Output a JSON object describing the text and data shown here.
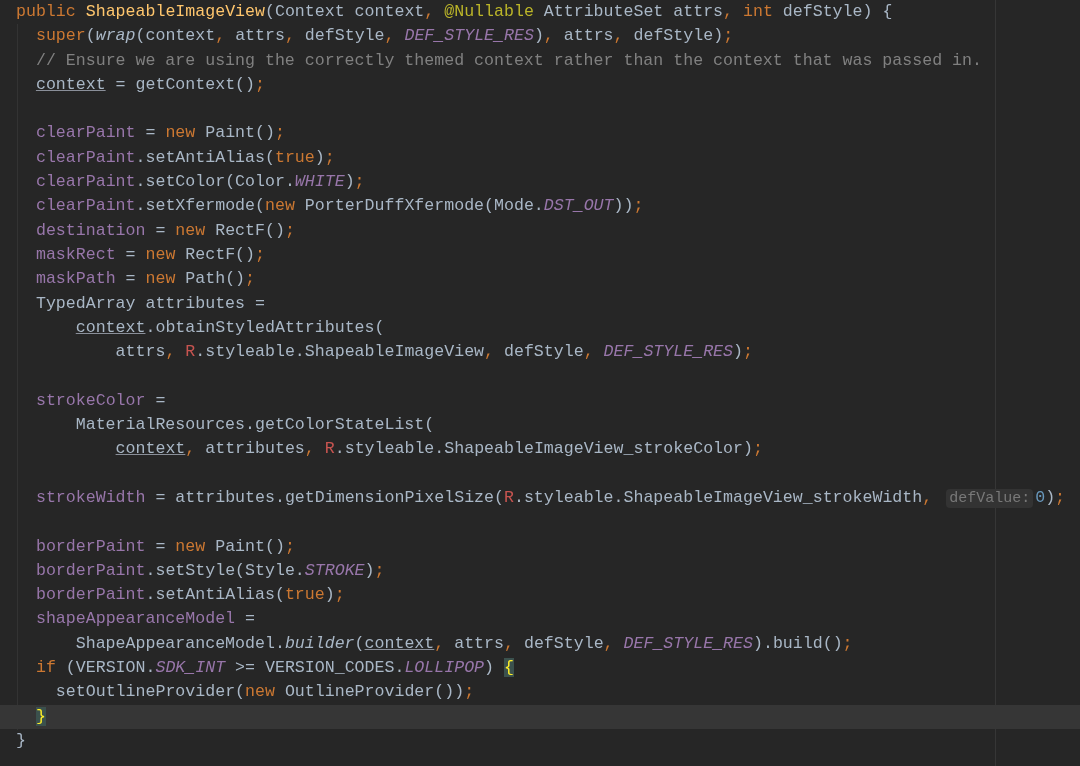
{
  "editor": {
    "lines": [
      {
        "current": false,
        "tokens": [
          {
            "kind": "keyword",
            "text": "public "
          },
          {
            "kind": "decl",
            "text": "ShapeableImageView"
          },
          {
            "kind": "plain",
            "text": "(Context context"
          },
          {
            "kind": "keyword",
            "text": ", "
          },
          {
            "kind": "annotation",
            "text": "@Nullable"
          },
          {
            "kind": "plain",
            "text": " AttributeSet attrs"
          },
          {
            "kind": "keyword",
            "text": ", int "
          },
          {
            "kind": "plain",
            "text": "defStyle) {"
          }
        ]
      },
      {
        "current": false,
        "tokens": [
          {
            "kind": "keyword",
            "text": "  super"
          },
          {
            "kind": "plain",
            "text": "("
          },
          {
            "kind": "italic",
            "text": "wrap"
          },
          {
            "kind": "plain",
            "text": "(context"
          },
          {
            "kind": "keyword",
            "text": ", "
          },
          {
            "kind": "plain",
            "text": "attrs"
          },
          {
            "kind": "keyword",
            "text": ", "
          },
          {
            "kind": "plain",
            "text": "defStyle"
          },
          {
            "kind": "keyword",
            "text": ", "
          },
          {
            "kind": "constant",
            "text": "DEF_STYLE_RES"
          },
          {
            "kind": "plain",
            "text": ")"
          },
          {
            "kind": "keyword",
            "text": ", "
          },
          {
            "kind": "plain",
            "text": "attrs"
          },
          {
            "kind": "keyword",
            "text": ", "
          },
          {
            "kind": "plain",
            "text": "defStyle)"
          },
          {
            "kind": "keyword",
            "text": ";"
          }
        ]
      },
      {
        "current": false,
        "tokens": [
          {
            "kind": "comment",
            "text": "  // Ensure we are using the correctly themed context rather than the context that was passed in."
          }
        ]
      },
      {
        "current": false,
        "tokens": [
          {
            "kind": "underline",
            "text": "  context"
          },
          {
            "kind": "plain",
            "text": " = getContext()"
          },
          {
            "kind": "keyword",
            "text": ";"
          }
        ]
      },
      {
        "current": false
      },
      {
        "current": false,
        "tokens": [
          {
            "kind": "field",
            "text": "  clearPaint"
          },
          {
            "kind": "plain",
            "text": " = "
          },
          {
            "kind": "keyword",
            "text": "new "
          },
          {
            "kind": "plain",
            "text": "Paint()"
          },
          {
            "kind": "keyword",
            "text": ";"
          }
        ]
      },
      {
        "current": false,
        "tokens": [
          {
            "kind": "field",
            "text": "  clearPaint"
          },
          {
            "kind": "plain",
            "text": ".setAntiAlias("
          },
          {
            "kind": "keyword",
            "text": "true"
          },
          {
            "kind": "plain",
            "text": ")"
          },
          {
            "kind": "keyword",
            "text": ";"
          }
        ]
      },
      {
        "current": false,
        "tokens": [
          {
            "kind": "field",
            "text": "  clearPaint"
          },
          {
            "kind": "plain",
            "text": ".setColor(Color."
          },
          {
            "kind": "constant",
            "text": "WHITE"
          },
          {
            "kind": "plain",
            "text": ")"
          },
          {
            "kind": "keyword",
            "text": ";"
          }
        ]
      },
      {
        "current": false,
        "tokens": [
          {
            "kind": "field",
            "text": "  clearPaint"
          },
          {
            "kind": "plain",
            "text": ".setXfermode("
          },
          {
            "kind": "keyword",
            "text": "new "
          },
          {
            "kind": "plain",
            "text": "PorterDuffXfermode(Mode."
          },
          {
            "kind": "constant",
            "text": "DST_OUT"
          },
          {
            "kind": "plain",
            "text": "))"
          },
          {
            "kind": "keyword",
            "text": ";"
          }
        ]
      },
      {
        "current": false,
        "tokens": [
          {
            "kind": "field",
            "text": "  destination"
          },
          {
            "kind": "plain",
            "text": " = "
          },
          {
            "kind": "keyword",
            "text": "new "
          },
          {
            "kind": "plain",
            "text": "RectF()"
          },
          {
            "kind": "keyword",
            "text": ";"
          }
        ]
      },
      {
        "current": false,
        "tokens": [
          {
            "kind": "field",
            "text": "  maskRect"
          },
          {
            "kind": "plain",
            "text": " = "
          },
          {
            "kind": "keyword",
            "text": "new "
          },
          {
            "kind": "plain",
            "text": "RectF()"
          },
          {
            "kind": "keyword",
            "text": ";"
          }
        ]
      },
      {
        "current": false,
        "tokens": [
          {
            "kind": "field",
            "text": "  maskPath"
          },
          {
            "kind": "plain",
            "text": " = "
          },
          {
            "kind": "keyword",
            "text": "new "
          },
          {
            "kind": "plain",
            "text": "Path()"
          },
          {
            "kind": "keyword",
            "text": ";"
          }
        ]
      },
      {
        "current": false,
        "tokens": [
          {
            "kind": "plain",
            "text": "  TypedArray attributes ="
          }
        ]
      },
      {
        "current": false,
        "tokens": [
          {
            "kind": "underline",
            "text": "      context"
          },
          {
            "kind": "plain",
            "text": ".obtainStyledAttributes("
          }
        ]
      },
      {
        "current": false,
        "tokens": [
          {
            "kind": "plain",
            "text": "          attrs"
          },
          {
            "kind": "keyword",
            "text": ", "
          },
          {
            "kind": "resource",
            "text": "R"
          },
          {
            "kind": "plain",
            "text": ".styleable.ShapeableImageView"
          },
          {
            "kind": "keyword",
            "text": ", "
          },
          {
            "kind": "plain",
            "text": "defStyle"
          },
          {
            "kind": "keyword",
            "text": ", "
          },
          {
            "kind": "constant",
            "text": "DEF_STYLE_RES"
          },
          {
            "kind": "plain",
            "text": ")"
          },
          {
            "kind": "keyword",
            "text": ";"
          }
        ]
      },
      {
        "current": false
      },
      {
        "current": false,
        "tokens": [
          {
            "kind": "field",
            "text": "  strokeColor"
          },
          {
            "kind": "plain",
            "text": " ="
          }
        ]
      },
      {
        "current": false,
        "tokens": [
          {
            "kind": "plain",
            "text": "      MaterialResources.getColorStateList("
          }
        ]
      },
      {
        "current": false,
        "tokens": [
          {
            "kind": "underline",
            "text": "          context"
          },
          {
            "kind": "keyword",
            "text": ", "
          },
          {
            "kind": "plain",
            "text": "attributes"
          },
          {
            "kind": "keyword",
            "text": ", "
          },
          {
            "kind": "resource",
            "text": "R"
          },
          {
            "kind": "plain",
            "text": ".styleable.ShapeableImageView_strokeColor)"
          },
          {
            "kind": "keyword",
            "text": ";"
          }
        ]
      },
      {
        "current": false
      },
      {
        "current": false,
        "tokens": [
          {
            "kind": "field",
            "text": "  strokeWidth"
          },
          {
            "kind": "plain",
            "text": " = attributes.getDimensionPixelSize("
          },
          {
            "kind": "resource",
            "text": "R"
          },
          {
            "kind": "plain",
            "text": ".styleable.ShapeableImageView_strokeWidth"
          },
          {
            "kind": "keyword",
            "text": ", "
          },
          {
            "kind": "hint",
            "text": "defValue:"
          },
          {
            "kind": "number",
            "text": "0"
          },
          {
            "kind": "plain",
            "text": ")"
          },
          {
            "kind": "keyword",
            "text": ";"
          }
        ]
      },
      {
        "current": false
      },
      {
        "current": false,
        "tokens": [
          {
            "kind": "field",
            "text": "  borderPaint"
          },
          {
            "kind": "plain",
            "text": " = "
          },
          {
            "kind": "keyword",
            "text": "new "
          },
          {
            "kind": "plain",
            "text": "Paint()"
          },
          {
            "kind": "keyword",
            "text": ";"
          }
        ]
      },
      {
        "current": false,
        "tokens": [
          {
            "kind": "field",
            "text": "  borderPaint"
          },
          {
            "kind": "plain",
            "text": ".setStyle(Style."
          },
          {
            "kind": "constant",
            "text": "STROKE"
          },
          {
            "kind": "plain",
            "text": ")"
          },
          {
            "kind": "keyword",
            "text": ";"
          }
        ]
      },
      {
        "current": false,
        "tokens": [
          {
            "kind": "field",
            "text": "  borderPaint"
          },
          {
            "kind": "plain",
            "text": ".setAntiAlias("
          },
          {
            "kind": "keyword",
            "text": "true"
          },
          {
            "kind": "plain",
            "text": ")"
          },
          {
            "kind": "keyword",
            "text": ";"
          }
        ]
      },
      {
        "current": false,
        "tokens": [
          {
            "kind": "field",
            "text": "  shapeAppearanceModel"
          },
          {
            "kind": "plain",
            "text": " ="
          }
        ]
      },
      {
        "current": false,
        "tokens": [
          {
            "kind": "plain",
            "text": "      ShapeAppearanceModel."
          },
          {
            "kind": "italic",
            "text": "builder"
          },
          {
            "kind": "plain",
            "text": "("
          },
          {
            "kind": "underline",
            "text": "context"
          },
          {
            "kind": "keyword",
            "text": ", "
          },
          {
            "kind": "plain",
            "text": "attrs"
          },
          {
            "kind": "keyword",
            "text": ", "
          },
          {
            "kind": "plain",
            "text": "defStyle"
          },
          {
            "kind": "keyword",
            "text": ", "
          },
          {
            "kind": "constant",
            "text": "DEF_STYLE_RES"
          },
          {
            "kind": "plain",
            "text": ").build()"
          },
          {
            "kind": "keyword",
            "text": ";"
          }
        ]
      },
      {
        "current": false,
        "tokens": [
          {
            "kind": "keyword",
            "text": "  if "
          },
          {
            "kind": "plain",
            "text": "(VERSION."
          },
          {
            "kind": "constant",
            "text": "SDK_INT"
          },
          {
            "kind": "plain",
            "text": " >= VERSION_CODES."
          },
          {
            "kind": "constant",
            "text": "LOLLIPOP"
          },
          {
            "kind": "plain",
            "text": ") "
          },
          {
            "kind": "brace",
            "text": "{"
          }
        ]
      },
      {
        "current": false,
        "tokens": [
          {
            "kind": "plain",
            "text": "    setOutlineProvider("
          },
          {
            "kind": "keyword",
            "text": "new "
          },
          {
            "kind": "plain",
            "text": "OutlineProvider())"
          },
          {
            "kind": "keyword",
            "text": ";"
          }
        ]
      },
      {
        "current": true,
        "tokens": [
          {
            "kind": "brace",
            "text": "  }"
          }
        ]
      },
      {
        "current": false,
        "tokens": [
          {
            "kind": "plain",
            "text": "}"
          }
        ]
      }
    ]
  }
}
